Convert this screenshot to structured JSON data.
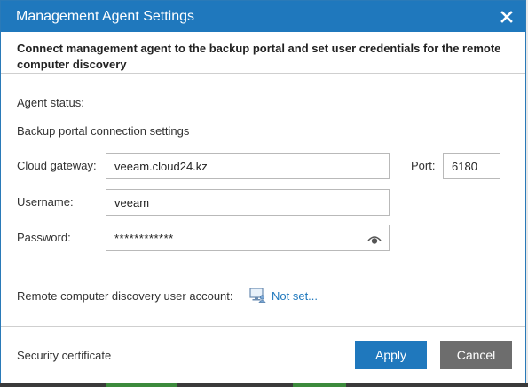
{
  "dialog": {
    "title": "Management Agent Settings",
    "description": "Connect management agent to the backup portal and set user credentials for the remote computer discovery"
  },
  "agent_status": {
    "label": "Agent status:",
    "value": ""
  },
  "portal_settings": {
    "section_label": "Backup portal connection settings",
    "cloud_gateway_label": "Cloud gateway:",
    "cloud_gateway_value": "veeam.cloud24.kz",
    "port_label": "Port:",
    "port_value": "6180",
    "username_label": "Username:",
    "username_value": "veeam",
    "password_label": "Password:",
    "password_value": "************"
  },
  "discovery": {
    "label": "Remote computer discovery user account:",
    "link_text": "Not set..."
  },
  "footer": {
    "security_certificate_label": "Security certificate",
    "apply_label": "Apply",
    "cancel_label": "Cancel"
  },
  "colors": {
    "accent": "#1f78bd",
    "cancel_button": "#6d6d6d"
  },
  "icons": {
    "close": "close-icon",
    "password_toggle": "eye-icon",
    "computer_account": "computer-user-icon"
  }
}
